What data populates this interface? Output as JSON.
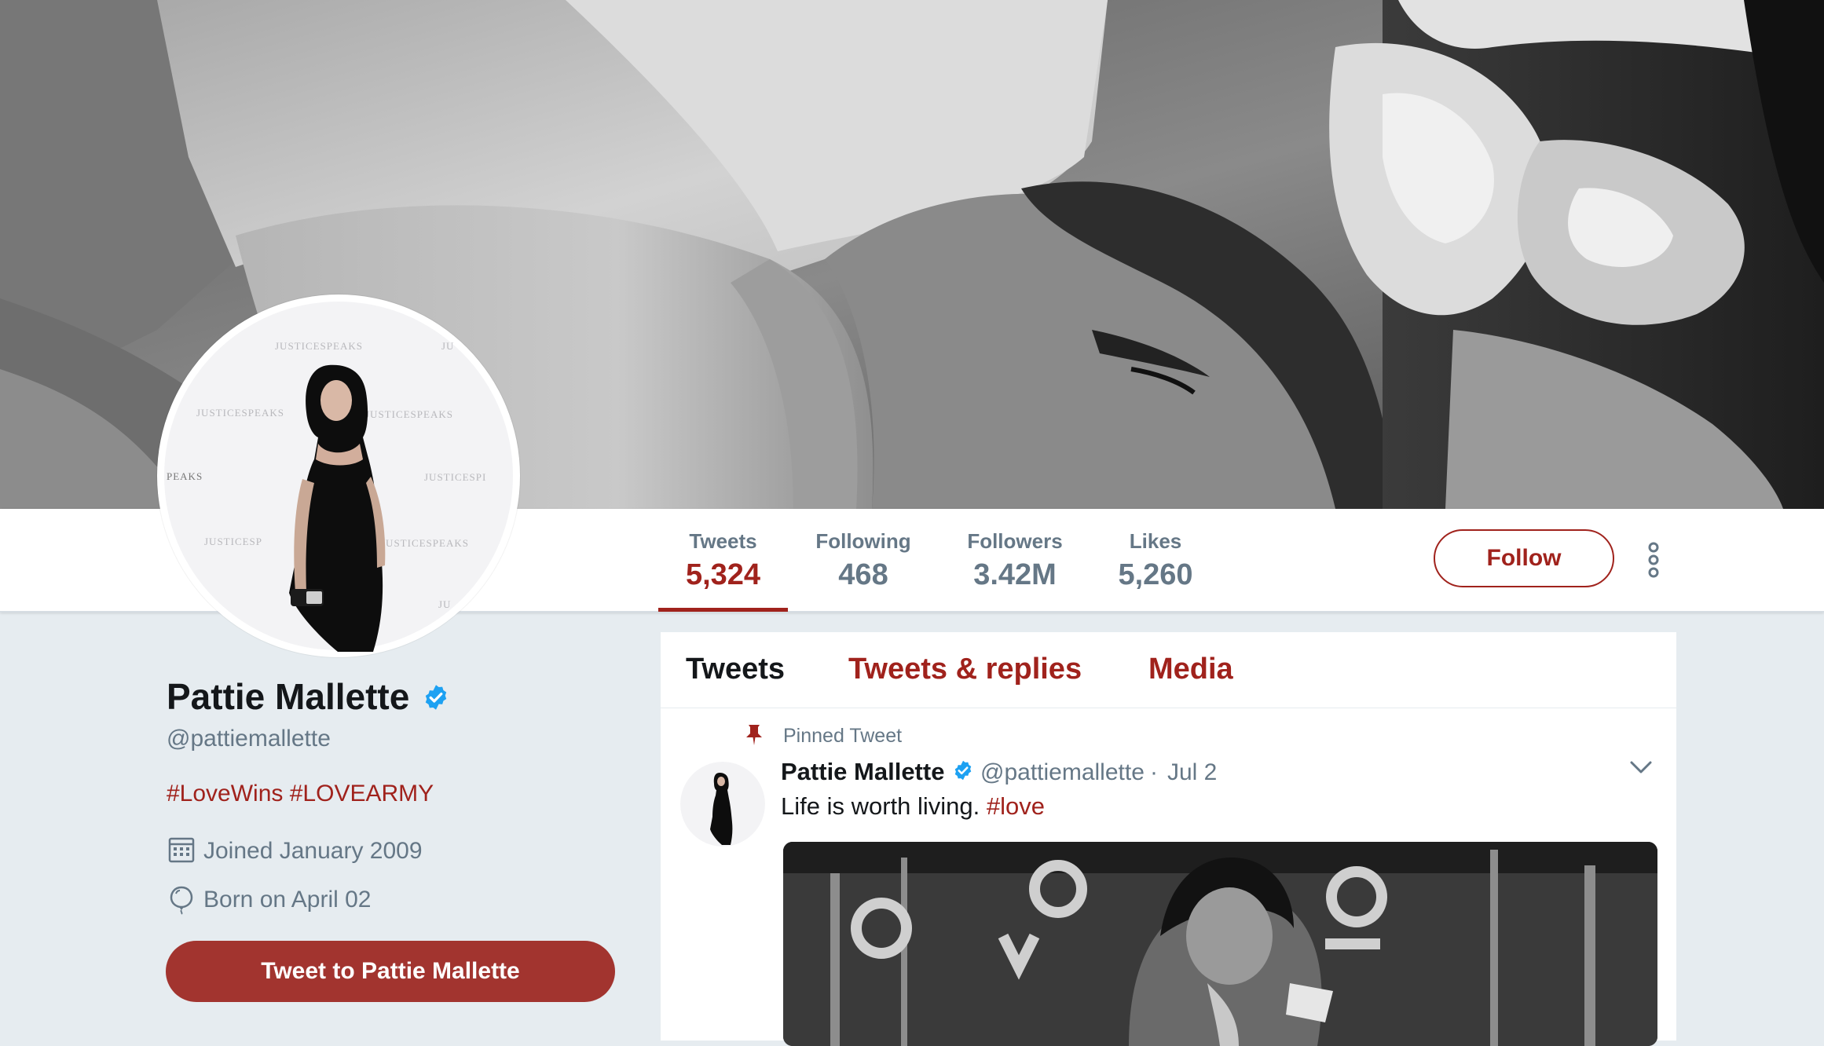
{
  "profile": {
    "name": "Pattie Mallette",
    "handle": "@pattiemallette",
    "bio_tags": [
      "#LoveWins",
      "#LOVEARMY"
    ],
    "joined": "Joined January 2009",
    "born": "Born on April 02",
    "tweet_to_label": "Tweet to Pattie Mallette"
  },
  "stats": [
    {
      "label": "Tweets",
      "value": "5,324",
      "active": true
    },
    {
      "label": "Following",
      "value": "468",
      "active": false
    },
    {
      "label": "Followers",
      "value": "3.42M",
      "active": false
    },
    {
      "label": "Likes",
      "value": "5,260",
      "active": false
    }
  ],
  "follow_label": "Follow",
  "avatar_backdrop_text": [
    "JUSTICESPEAKS",
    "JUSTICESPEAKS",
    "JUSTICESPEAKS",
    "PEAKS",
    "JUSTICESPI",
    "JUSTICESP",
    "JUSTICESPEAKS",
    "JU",
    "JU"
  ],
  "timeline": {
    "tabs": [
      {
        "label": "Tweets",
        "active": true
      },
      {
        "label": "Tweets & replies",
        "active": false
      },
      {
        "label": "Media",
        "active": false
      }
    ],
    "pinned_label": "Pinned Tweet",
    "tweet": {
      "author": "Pattie Mallette",
      "handle": "@pattiemallette",
      "separator": "·",
      "date": "Jul 2",
      "text": "Life is worth living. ",
      "hashtag": "#love"
    }
  },
  "colors": {
    "accent": "#a0221c",
    "tweet_button": "#a2342f",
    "verified": "#1da1f2",
    "muted_text": "#657786",
    "page_background": "#e6ecf0"
  },
  "icons": [
    "verified-badge-icon",
    "calendar-icon",
    "balloon-icon",
    "pin-icon",
    "chevron-down-icon",
    "more-vertical-icon"
  ]
}
